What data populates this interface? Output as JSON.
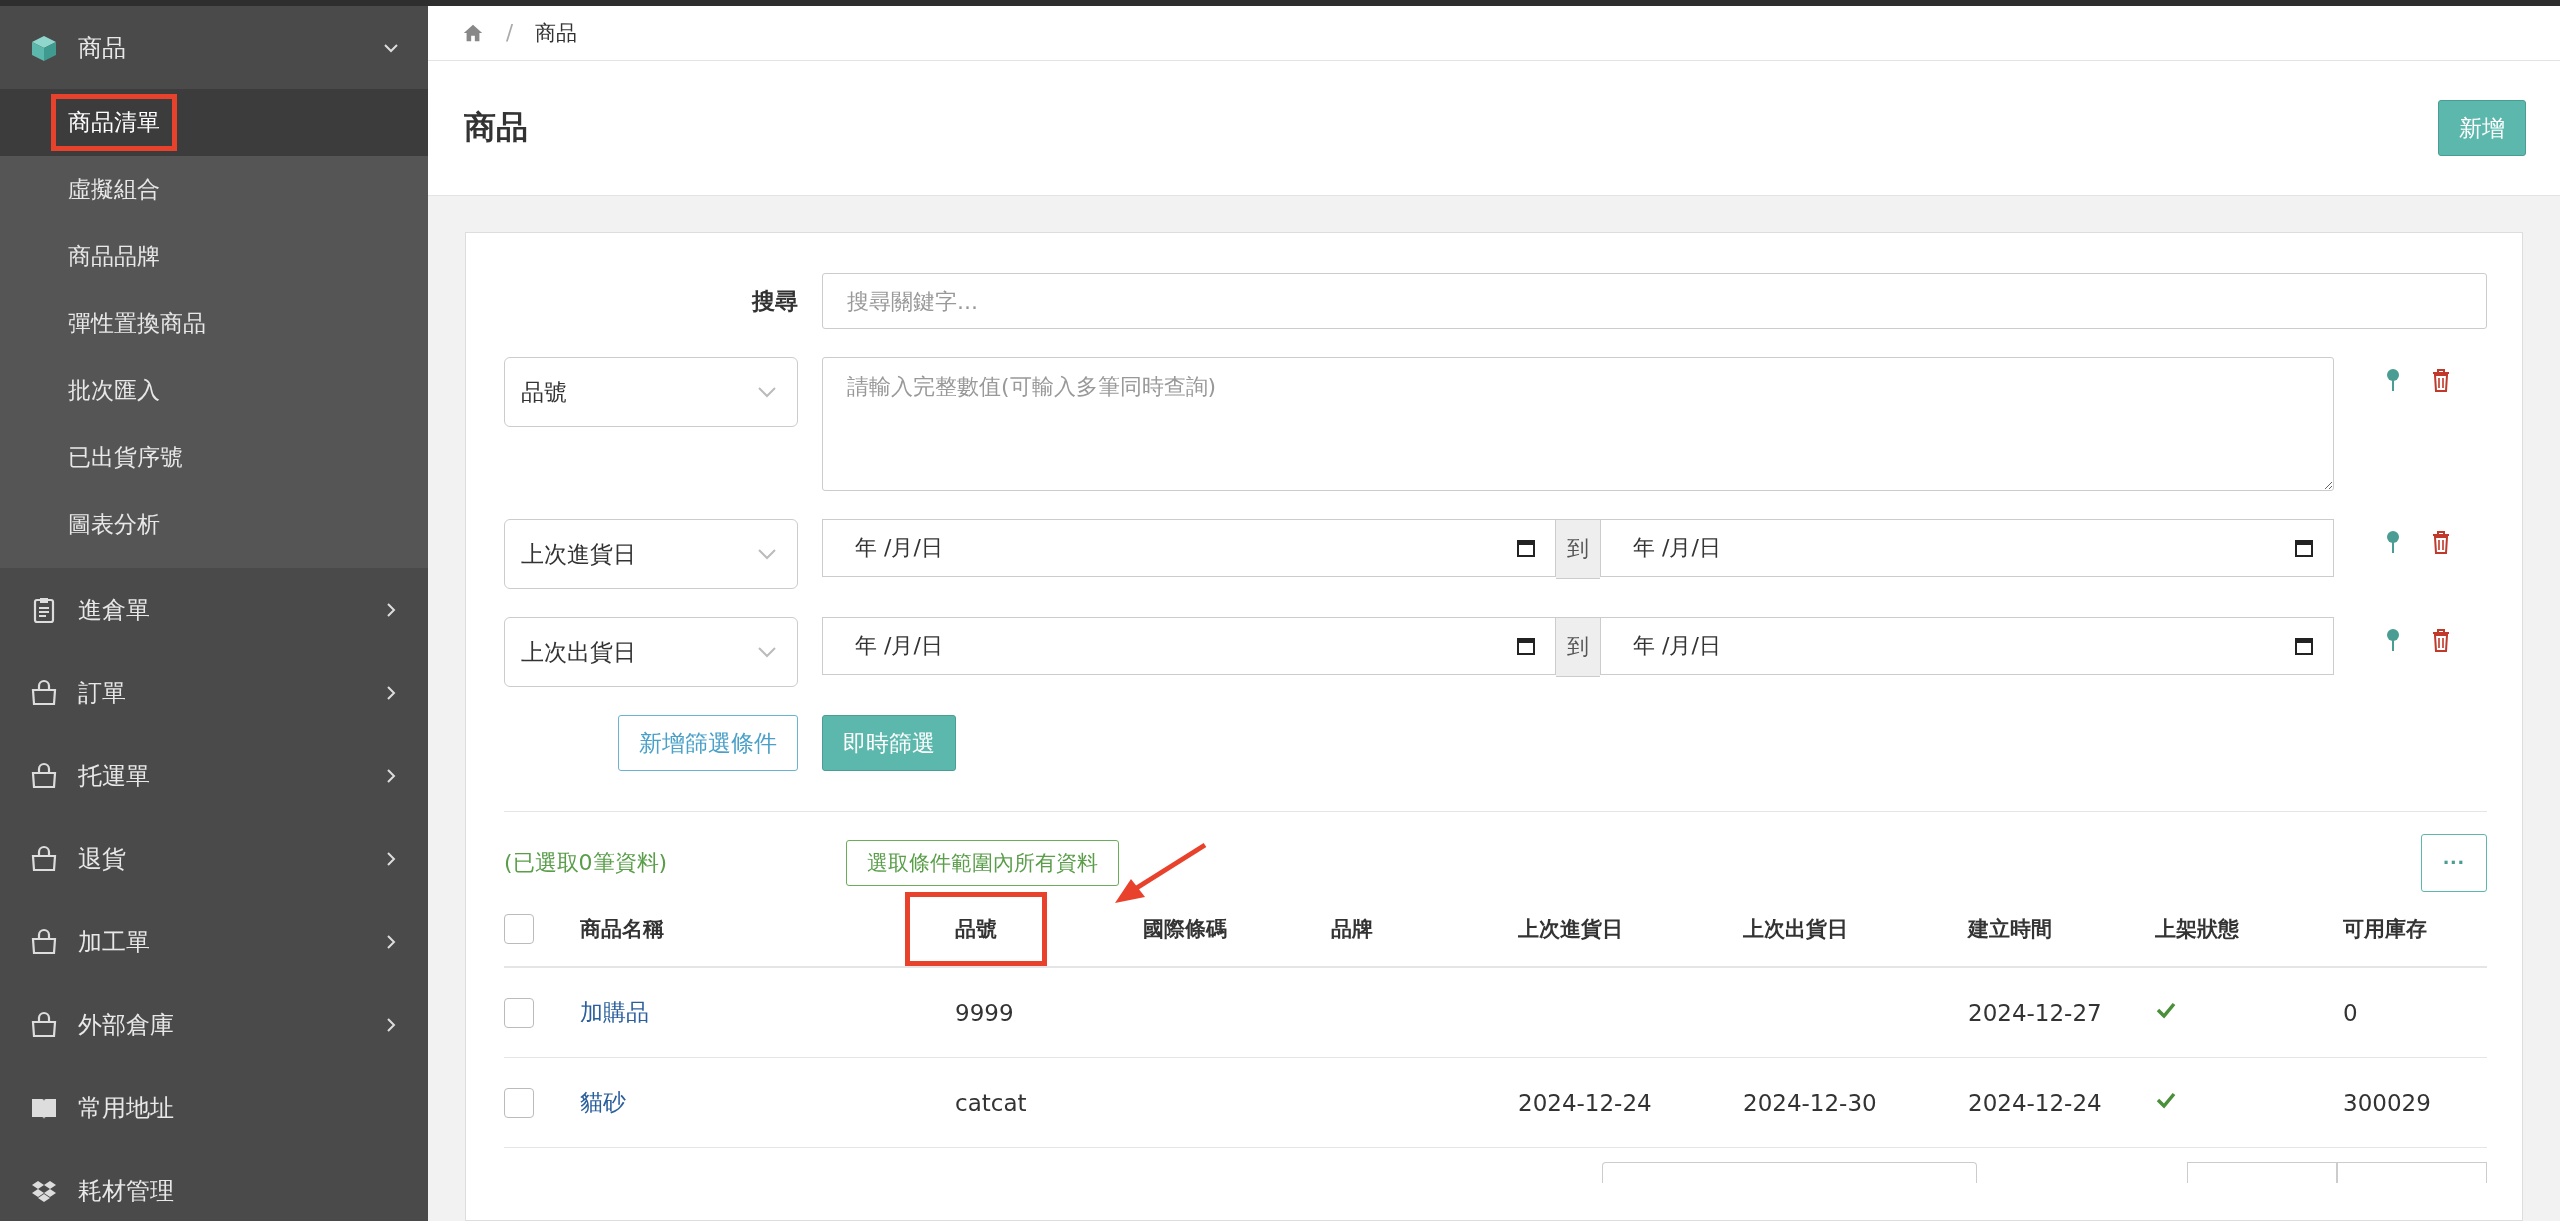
{
  "sidebar": {
    "items": [
      {
        "label": "商品",
        "expanded": true,
        "children": [
          {
            "label": "商品清單",
            "selected": true,
            "highlighted": true
          },
          {
            "label": "虛擬組合",
            "selected": false,
            "highlighted": false
          },
          {
            "label": "商品品牌",
            "selected": false,
            "highlighted": false
          },
          {
            "label": "彈性置換商品",
            "selected": false,
            "highlighted": false
          },
          {
            "label": "批次匯入",
            "selected": false,
            "highlighted": false
          },
          {
            "label": "已出貨序號",
            "selected": false,
            "highlighted": false
          },
          {
            "label": "圖表分析",
            "selected": false,
            "highlighted": false
          }
        ]
      },
      {
        "label": "進倉單",
        "expanded": false
      },
      {
        "label": "訂單",
        "expanded": false
      },
      {
        "label": "托運單",
        "expanded": false
      },
      {
        "label": "退貨",
        "expanded": false
      },
      {
        "label": "加工單",
        "expanded": false
      },
      {
        "label": "外部倉庫",
        "expanded": false
      },
      {
        "label": "常用地址"
      },
      {
        "label": "耗材管理"
      }
    ]
  },
  "breadcrumb": {
    "separator": "/",
    "current": "商品"
  },
  "page": {
    "title": "商品",
    "add_button": "新增"
  },
  "filters": {
    "search": {
      "label": "搜尋",
      "placeholder": "搜尋關鍵字..."
    },
    "conditions": [
      {
        "kind": "text",
        "field": "品號",
        "placeholder": "請輸入完整數值(可輸入多筆同時查詢)"
      },
      {
        "kind": "daterange",
        "field": "上次進貨日",
        "from_placeholder": "年 /月/日",
        "separator": "到",
        "to_placeholder": "年 /月/日"
      },
      {
        "kind": "daterange",
        "field": "上次出貨日",
        "from_placeholder": "年 /月/日",
        "separator": "到",
        "to_placeholder": "年 /月/日"
      }
    ],
    "add_condition_button": "新增篩選條件",
    "apply_button": "即時篩選"
  },
  "table": {
    "all_checked": false,
    "selected_count": "(已選取0筆資料)",
    "select_all_button": "選取條件範圍內所有資料",
    "more_button": "···",
    "columns": [
      {
        "label": "商品名稱",
        "highlighted": false
      },
      {
        "label": "品號",
        "highlighted": true
      },
      {
        "label": "國際條碼",
        "highlighted": false
      },
      {
        "label": "品牌",
        "highlighted": false
      },
      {
        "label": "上次進貨日",
        "highlighted": false
      },
      {
        "label": "上次出貨日",
        "highlighted": false
      },
      {
        "label": "建立時間",
        "highlighted": false
      },
      {
        "label": "上架狀態",
        "highlighted": false
      },
      {
        "label": "可用庫存",
        "highlighted": false
      }
    ],
    "rows": [
      {
        "checked": false,
        "name": "加購品",
        "sku": "9999",
        "created": "2024-12-27",
        "listed": true,
        "stock": "0"
      },
      {
        "checked": false,
        "name": "貓砂",
        "sku": "catcat",
        "last_in": "2024-12-24",
        "last_out": "2024-12-30",
        "created": "2024-12-24",
        "listed": true,
        "stock": "300029"
      }
    ]
  }
}
